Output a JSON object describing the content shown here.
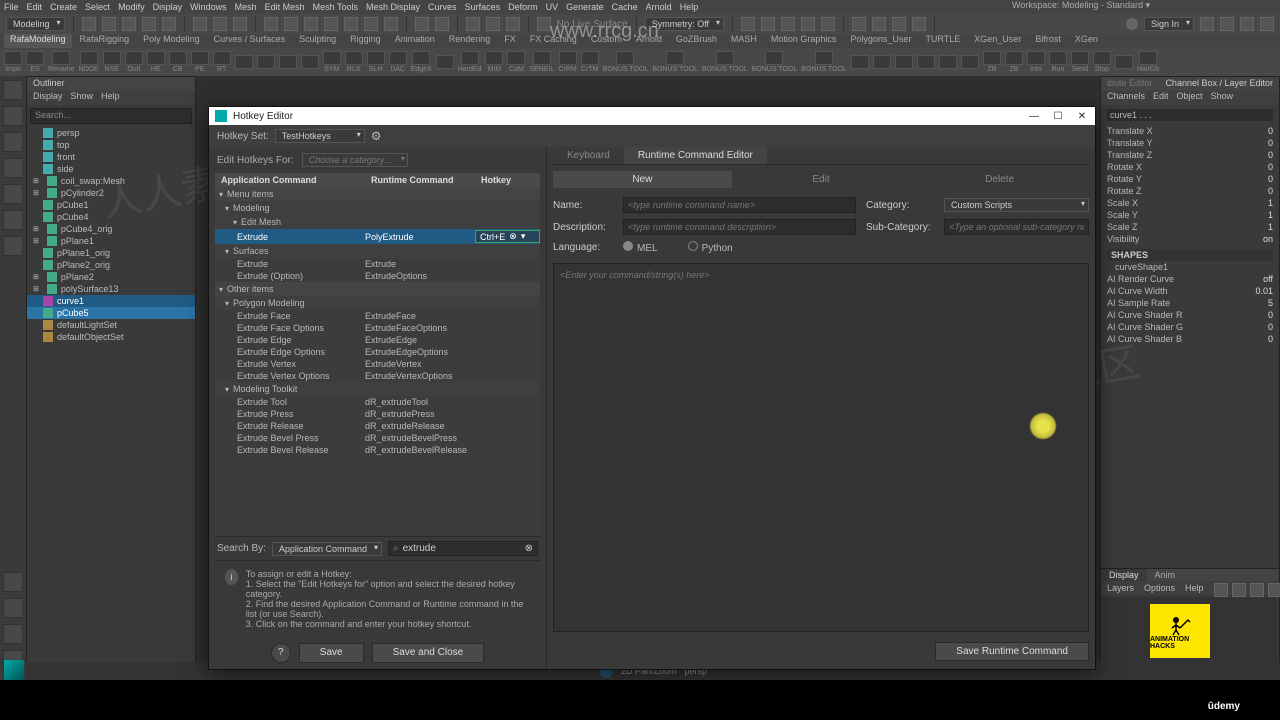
{
  "menubar": [
    "File",
    "Edit",
    "Create",
    "Select",
    "Modify",
    "Display",
    "Windows",
    "Mesh",
    "Edit Mesh",
    "Mesh Tools",
    "Mesh Display",
    "Curves",
    "Surfaces",
    "Deform",
    "UV",
    "Generate",
    "Cache",
    "Arnold",
    "Help"
  ],
  "workspace_label": "Workspace:",
  "workspace_value": "Modeling - Standard",
  "module_dropdown": "Modeling",
  "symmetry": "Symmetry: Off",
  "nolive": "No Live Surface",
  "signin": "Sign In",
  "shelf_tabs": [
    "RafaModeling",
    "RafaRigging",
    "Poly Modeling",
    "Curves / Surfaces",
    "Sculpting",
    "Rigging",
    "Animation",
    "Rendering",
    "FX",
    "FX Caching",
    "Custom",
    "Arnold",
    "GoZBrush",
    "MASH",
    "Motion Graphics",
    "Polygons_User",
    "TURTLE",
    "XGen_User",
    "Bifrost",
    "XGen"
  ],
  "shelf_active": "RafaModeling",
  "shelf_icons": [
    "Impo",
    "ES",
    "Rename",
    "NODE",
    "NSE",
    "Outl",
    "HE",
    "CB",
    "PE",
    "RT",
    "",
    "",
    "",
    "",
    "SYM",
    "RLX",
    "SLH",
    "DAC",
    "EdgeX",
    "",
    "HardEd",
    "MIM",
    "CaM",
    "SENEIL",
    "CrRM",
    "CrTM",
    "BONUS TOOL",
    "BONUS TOOL",
    "BONUS TOOL",
    "BONUS TOOL",
    "BONUS TOOL",
    "",
    "",
    "",
    "",
    "",
    "",
    "ZB",
    "ZB",
    "Info",
    "Run",
    "Send",
    "Stop",
    "",
    "HairGb"
  ],
  "outliner": {
    "title": "Outliner",
    "menu": [
      "Display",
      "Show",
      "Help"
    ],
    "search_placeholder": "Search...",
    "nodes": [
      {
        "label": "persp",
        "type": "cam"
      },
      {
        "label": "top",
        "type": "cam"
      },
      {
        "label": "front",
        "type": "cam"
      },
      {
        "label": "side",
        "type": "cam"
      },
      {
        "label": "coil_swap:Mesh",
        "type": "mesh",
        "exp": true
      },
      {
        "label": "pCylinder2",
        "type": "mesh",
        "exp": true
      },
      {
        "label": "pCube1",
        "type": "mesh"
      },
      {
        "label": "pCube4",
        "type": "mesh"
      },
      {
        "label": "pCube4_orig",
        "type": "mesh",
        "exp": true
      },
      {
        "label": "pPlane1",
        "type": "mesh",
        "exp": true
      },
      {
        "label": "pPlane1_orig",
        "type": "mesh"
      },
      {
        "label": "pPlane2_orig",
        "type": "mesh"
      },
      {
        "label": "pPlane2",
        "type": "mesh",
        "exp": true
      },
      {
        "label": "polySurface13",
        "type": "mesh",
        "exp": true
      },
      {
        "label": "curve1",
        "type": "curve",
        "sel": 1
      },
      {
        "label": "pCube5",
        "type": "mesh",
        "sel": 2
      },
      {
        "label": "defaultLightSet",
        "type": "set"
      },
      {
        "label": "defaultObjectSet",
        "type": "set"
      }
    ]
  },
  "dialog": {
    "title": "Hotkey Editor",
    "hotkeyset_label": "Hotkey Set:",
    "hotkeyset_value": "TestHotkeys",
    "edit_for_label": "Edit Hotkeys For:",
    "edit_for_value": "Choose a category…",
    "columns": [
      "Application Command",
      "Runtime Command",
      "Hotkey"
    ],
    "tree": [
      {
        "cat": "Menu items"
      },
      {
        "subcat": "Modeling"
      },
      {
        "subcat2": "Edit Mesh"
      },
      {
        "row": [
          "Extrude",
          "PolyExtrude",
          "Ctrl+E"
        ],
        "sel": true
      },
      {
        "subcat": "Surfaces"
      },
      {
        "row": [
          "Extrude",
          "Extrude",
          ""
        ]
      },
      {
        "row": [
          "Extrude (Option)",
          "ExtrudeOptions",
          ""
        ]
      },
      {
        "cat": "Other items"
      },
      {
        "subcat": "Polygon Modeling"
      },
      {
        "row": [
          "Extrude Face",
          "ExtrudeFace",
          ""
        ]
      },
      {
        "row": [
          "Extrude Face Options",
          "ExtrudeFaceOptions",
          ""
        ]
      },
      {
        "row": [
          "Extrude Edge",
          "ExtrudeEdge",
          ""
        ]
      },
      {
        "row": [
          "Extrude Edge Options",
          "ExtrudeEdgeOptions",
          ""
        ]
      },
      {
        "row": [
          "Extrude Vertex",
          "ExtrudeVertex",
          ""
        ]
      },
      {
        "row": [
          "Extrude Vertex Options",
          "ExtrudeVertexOptions",
          ""
        ]
      },
      {
        "subcat": "Modeling Toolkit"
      },
      {
        "row": [
          "Extrude Tool",
          "dR_extrudeTool",
          ""
        ]
      },
      {
        "row": [
          "Extrude Press",
          "dR_extrudePress",
          ""
        ]
      },
      {
        "row": [
          "Extrude Release",
          "dR_extrudeRelease",
          ""
        ]
      },
      {
        "row": [
          "Extrude Bevel Press",
          "dR_extrudeBevelPress",
          ""
        ]
      },
      {
        "row": [
          "Extrude Bevel Release",
          "dR_extrudeBevelRelease",
          ""
        ]
      }
    ],
    "search_by_label": "Search By:",
    "search_by_value": "Application Command",
    "search_value": "extrude",
    "help_title": "To assign or edit a Hotkey:",
    "help_lines": [
      "1. Select the \"Edit Hotkeys for\" option and select the desired hotkey category.",
      "2. Find the desired Application Command or Runtime command in the list (or use Search).",
      "3. Click on the command and enter your hotkey shortcut."
    ],
    "btn_save": "Save",
    "btn_saveclose": "Save and Close",
    "tabs": [
      "Keyboard",
      "Runtime Command Editor"
    ],
    "tab_active": 1,
    "actions": [
      "New",
      "Edit",
      "Delete"
    ],
    "action_active": 0,
    "name_label": "Name:",
    "name_placeholder": "<type runtime command name>",
    "desc_label": "Description:",
    "desc_placeholder": "<type runtime command description>",
    "cat_label": "Category:",
    "cat_value": "Custom Scripts",
    "subcat_label": "Sub-Category:",
    "subcat_placeholder": "<Type an optional sub-category name>",
    "lang_label": "Language:",
    "lang_opts": [
      "MEL",
      "Python"
    ],
    "lang_sel": 0,
    "script_placeholder": "<Enter your command/string(s) here>",
    "save_rt": "Save Runtime Command"
  },
  "channelbox": {
    "title": "Channel Box / Layer Editor",
    "othertab": "ibute Editor",
    "menu": [
      "Channels",
      "Edit",
      "Object",
      "Show"
    ],
    "object": "curve1 . . .",
    "attrs": [
      [
        "Translate X",
        "0"
      ],
      [
        "Translate Y",
        "0"
      ],
      [
        "Translate Z",
        "0"
      ],
      [
        "Rotate X",
        "0"
      ],
      [
        "Rotate Y",
        "0"
      ],
      [
        "Rotate Z",
        "0"
      ],
      [
        "Scale X",
        "1"
      ],
      [
        "Scale Y",
        "1"
      ],
      [
        "Scale Z",
        "1"
      ],
      [
        "Visibility",
        "on"
      ]
    ],
    "shapes_label": "SHAPES",
    "shape_name": "curveShape1",
    "shape_attrs": [
      [
        "AI Render Curve",
        "off"
      ],
      [
        "AI Curve Width",
        "0.01"
      ],
      [
        "AI Sample Rate",
        "5"
      ],
      [
        "AI Curve Shader R",
        "0"
      ],
      [
        "AI Curve Shader G",
        "0"
      ],
      [
        "AI Curve Shader B",
        "0"
      ]
    ],
    "layer_tabs": [
      "Display",
      "Anim"
    ],
    "layer_menu": [
      "Layers",
      "Options",
      "Help"
    ]
  },
  "status": {
    "mode": "2D Pan/Zoom",
    "cam": "persp"
  },
  "logo": "ANIMATION HACKS",
  "udemy": "ûdemy"
}
